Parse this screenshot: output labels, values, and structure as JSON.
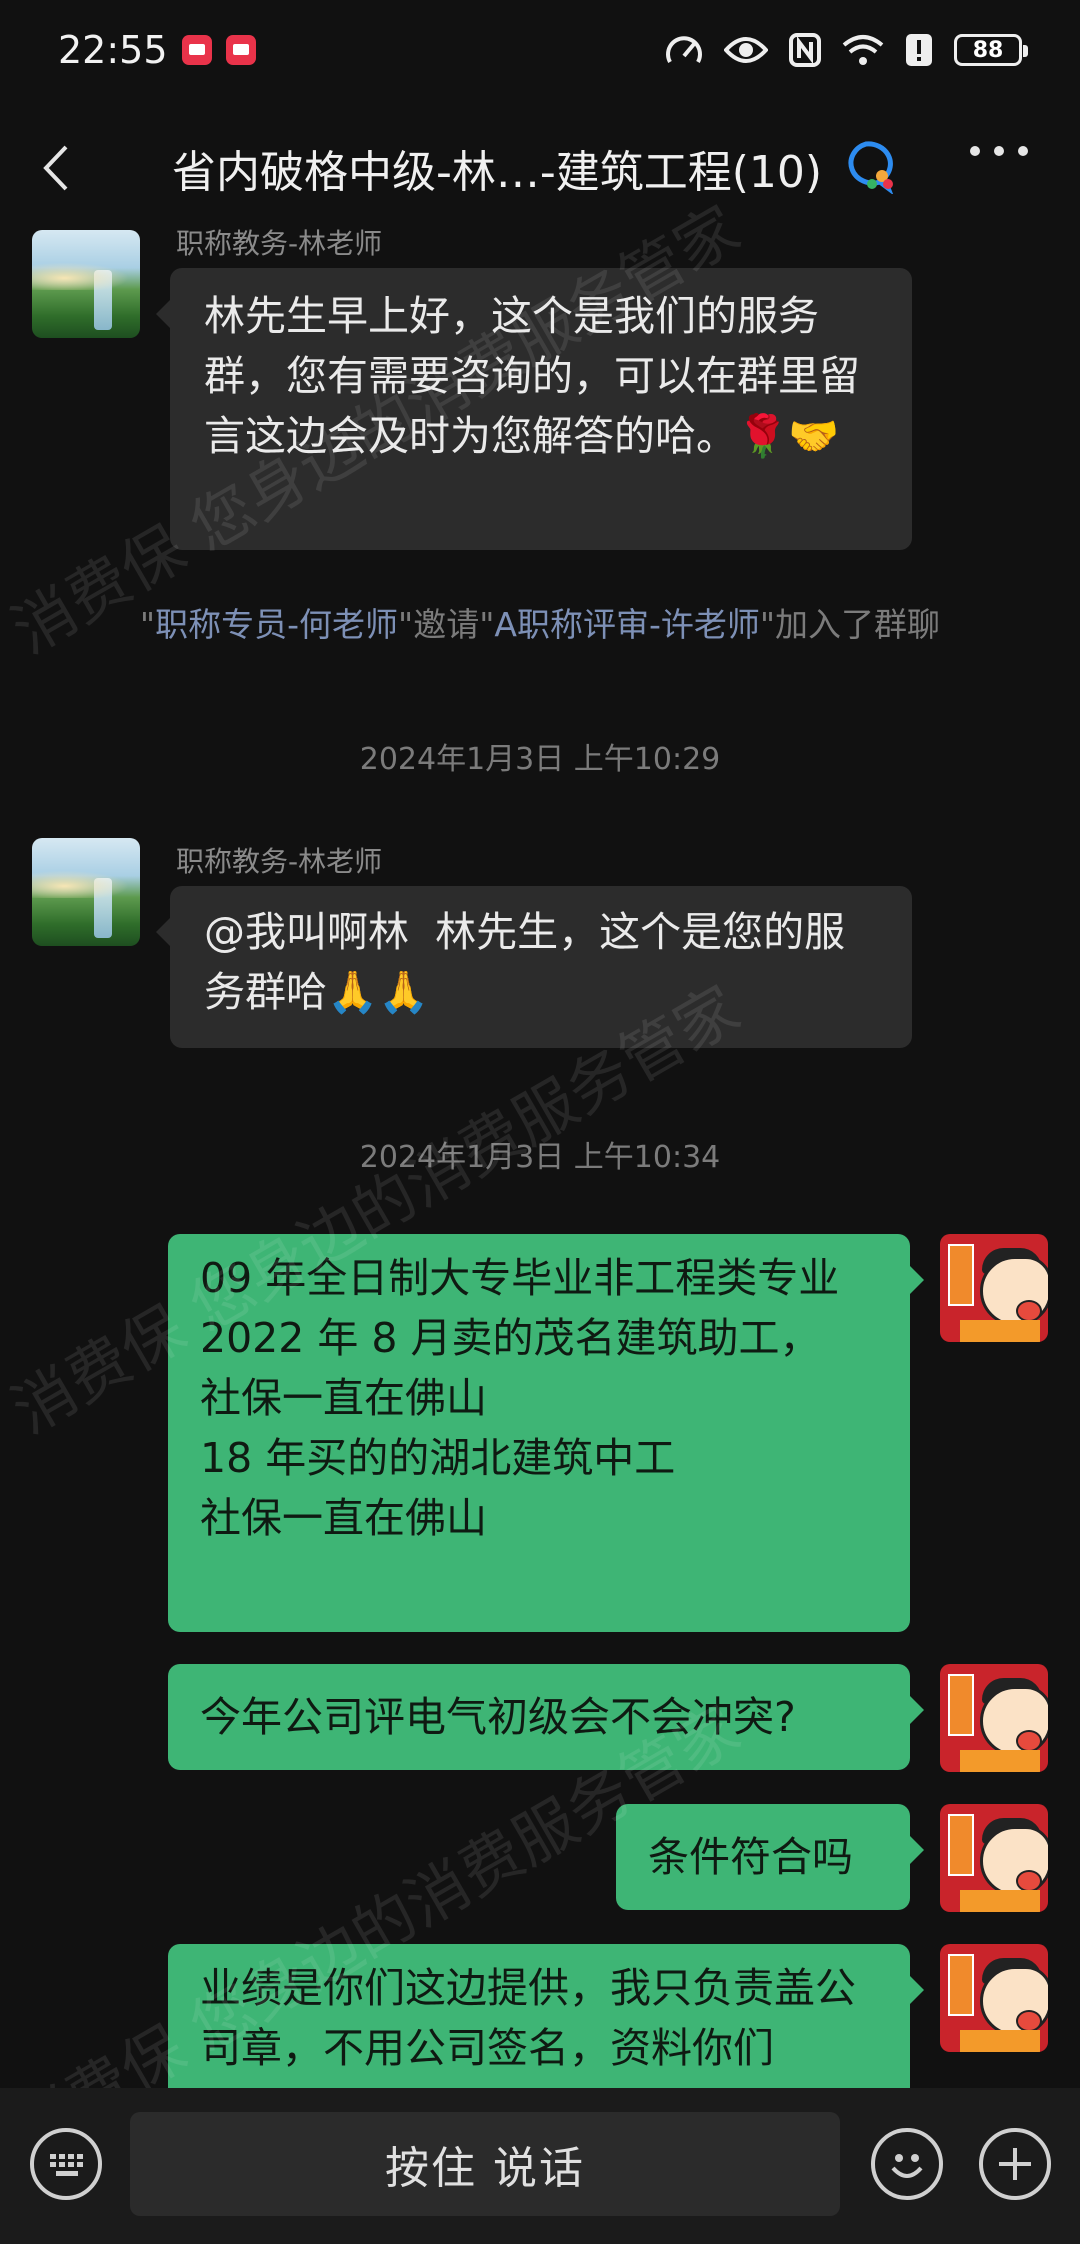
{
  "status_bar": {
    "time": "22:55",
    "battery": "88"
  },
  "header": {
    "title": "省内破格中级-林…-建筑工程(10)"
  },
  "messages": {
    "m1_sender": "职称教务-林老师",
    "m1_text": "林先生早上好，这个是我们的服务群，您有需要咨询的，可以在群里留言这边会及时为您解答的哈。🌹🤝",
    "sys_q1": "\"",
    "sys_user1": "职称专员-何老师",
    "sys_q2": "\"邀请\"",
    "sys_user2": "A职称评审-许老师",
    "sys_q3": "\"加入了群聊",
    "time1": "2024年1月3日 上午10:29",
    "m2_sender": "职称教务-林老师",
    "m2_text": "@我叫啊林  林先生，这个是您的服务群哈🙏🙏",
    "time2": "2024年1月3日 上午10:34",
    "m3_text": "09 年全日制大专毕业非工程类专业\n2022 年 8 月卖的茂名建筑助工，\n社保一直在佛山\n18 年买的的湖北建筑中工\n社保一直在佛山",
    "m4_text": "今年公司评电气初级会不会冲突?",
    "m5_text": "条件符合吗",
    "m6_text": "业绩是你们这边提供，我只负责盖公司章，不用公司签名，资料你们"
  },
  "input_bar": {
    "hold_to_talk": "按住 说话"
  },
  "watermark": {
    "text1": "消费保 您身边的消费服务管家",
    "text2": "消费保 您身边的消费服务管家",
    "text3": "消费保 您身边的消费服务管家"
  }
}
